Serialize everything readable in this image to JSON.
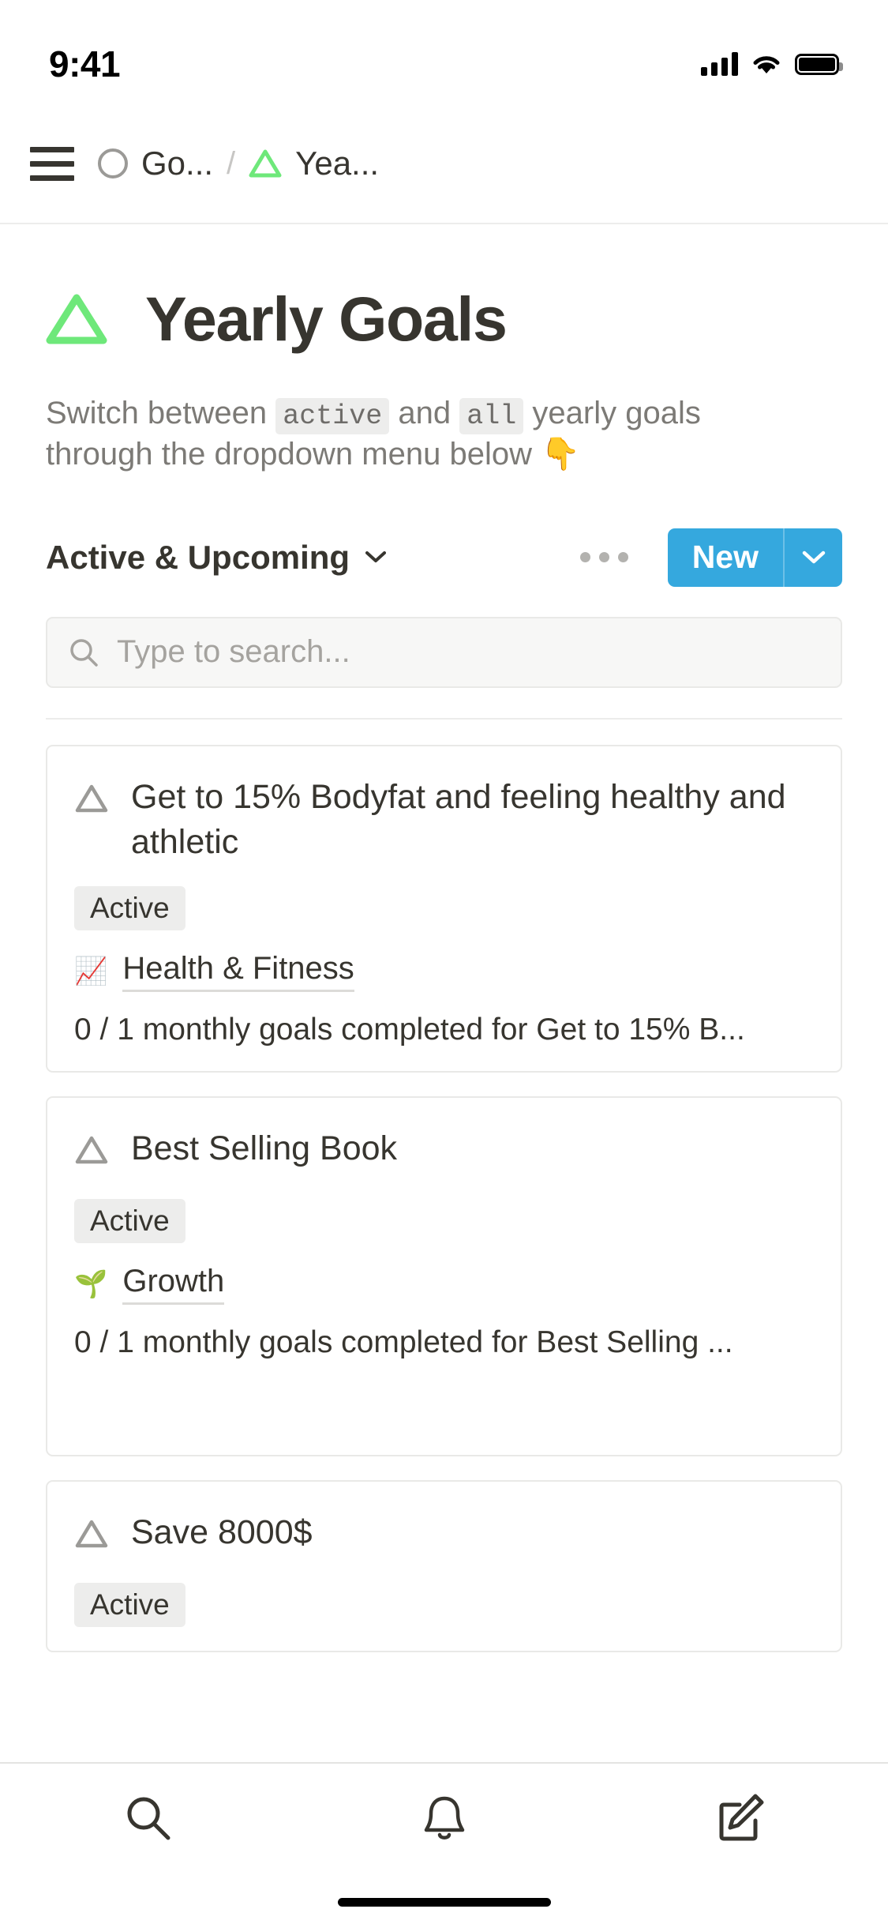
{
  "status_bar": {
    "time": "9:41",
    "cellular_icon": "cellular-bars-icon",
    "wifi_icon": "wifi-icon",
    "battery_icon": "battery-full-icon"
  },
  "navbar": {
    "menu_icon": "hamburger-menu-icon",
    "breadcrumbs": [
      {
        "icon": "circle-icon",
        "label": "Go..."
      },
      {
        "icon": "green-triangle-icon",
        "label": "Yea..."
      }
    ],
    "separator": "/"
  },
  "page": {
    "icon": "green-triangle-icon",
    "title": "Yearly Goals",
    "description": {
      "part1": "Switch between ",
      "chip1": "active",
      "part2": " and ",
      "chip2": "all",
      "part3": " yearly goals through the dropdown menu below ",
      "emoji": "👇"
    }
  },
  "toolbar": {
    "view_name": "Active & Upcoming",
    "view_chevron_icon": "chevron-down-icon",
    "more_icon": "ellipsis-icon",
    "new_label": "New",
    "new_chevron_icon": "chevron-down-icon"
  },
  "search": {
    "icon": "search-icon",
    "placeholder": "Type to search...",
    "value": ""
  },
  "cards": [
    {
      "icon": "triangle-outline-icon",
      "title": "Get to 15% Bodyfat and feeling healthy and athletic",
      "status": "Active",
      "relation_emoji": "📈",
      "relation_label": "Health & Fitness",
      "progress": "0 / 1 monthly goals completed for Get to 15% B..."
    },
    {
      "icon": "triangle-outline-icon",
      "title": "Best Selling Book",
      "status": "Active",
      "relation_emoji": "🌱",
      "relation_label": "Growth",
      "progress": "0 / 1 monthly goals completed for Best Selling ..."
    },
    {
      "icon": "triangle-outline-icon",
      "title": "Save 8000$",
      "status": "Active",
      "relation_emoji": "",
      "relation_label": "",
      "progress": ""
    }
  ],
  "tabbar": {
    "items": [
      {
        "icon": "search-icon",
        "name": "tab-search"
      },
      {
        "icon": "bell-icon",
        "name": "tab-notifications"
      },
      {
        "icon": "compose-icon",
        "name": "tab-compose"
      }
    ]
  },
  "colors": {
    "accent_blue": "#35a8de",
    "green_triangle": "#6ee87a",
    "text": "#37352f",
    "muted": "#7c7a76",
    "chip_bg": "#ededec",
    "border": "#e9e9e7"
  }
}
